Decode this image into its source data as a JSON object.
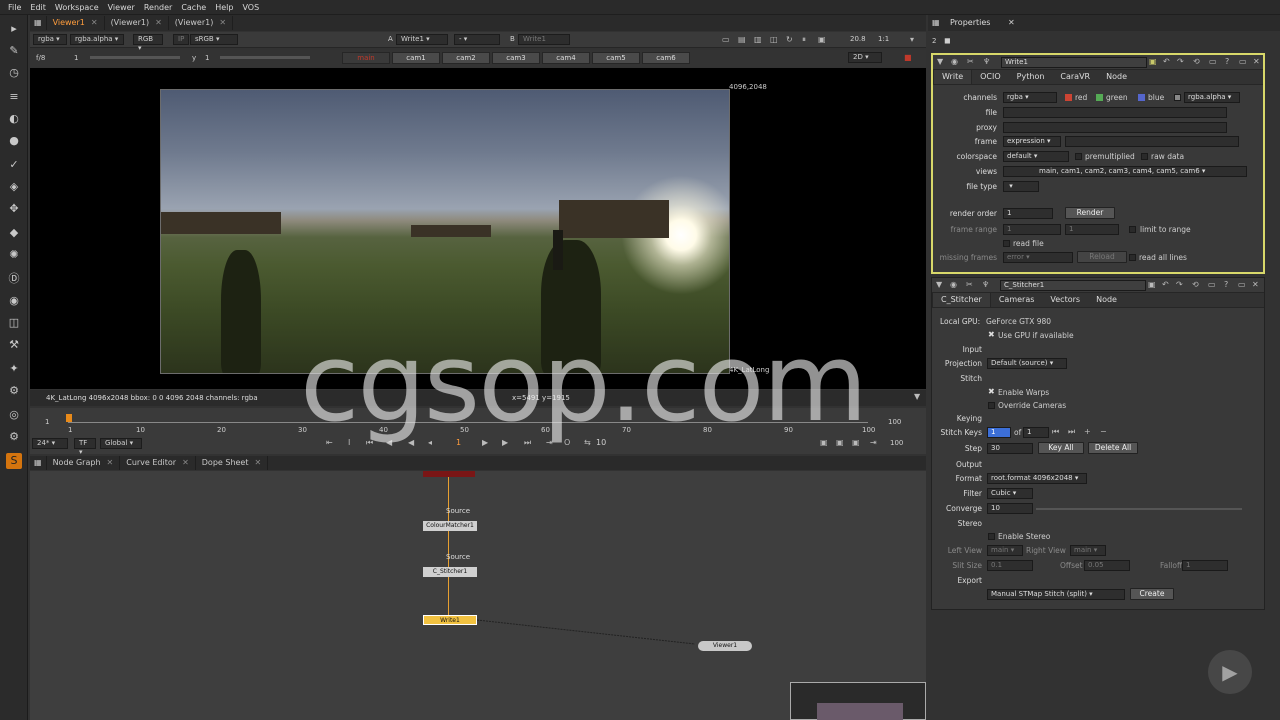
{
  "menu": [
    "File",
    "Edit",
    "Workspace",
    "Viewer",
    "Render",
    "Cache",
    "Help",
    "VOS"
  ],
  "viewer_tabs": [
    "Viewer1",
    "(Viewer1)",
    "(Viewer1)"
  ],
  "viewer_bar": {
    "channel": "rgba",
    "alpha": "rgba.alpha",
    "color": "RGB",
    "ip": "IP",
    "lut": "sRGB",
    "a_label": "A",
    "a_input": "Write1",
    "a_dash": "-",
    "b_label": "B",
    "b_input": "Write1",
    "zoom": "20.8",
    "ratio": "1:1"
  },
  "viewer_bar2": {
    "fstop": "f/8",
    "gain": "1",
    "y_label": "y",
    "y_value": "1",
    "mode": "2D"
  },
  "cams": [
    "main",
    "cam1",
    "cam2",
    "cam3",
    "cam4",
    "cam5",
    "cam6"
  ],
  "viewport": {
    "format_label": "4K_LatLong",
    "corner_label": "4096,2048"
  },
  "info": {
    "left": "4K_LatLong 4096x2048  bbox: 0 0 4096 2048 channels: rgba",
    "coords": "x=5491 y=1915"
  },
  "timeline": {
    "ticks": [
      "1",
      "10",
      "20",
      "30",
      "40",
      "50",
      "60",
      "70",
      "80",
      "90",
      "100"
    ],
    "start": "1",
    "end": "100",
    "fps": "24*",
    "tf": "TF",
    "global": "Global",
    "frame": "1",
    "step": "10",
    "out": "100"
  },
  "ng_tabs": [
    "Node Graph",
    "Curve Editor",
    "Dope Sheet"
  ],
  "nodes": {
    "source1": "Source",
    "colour": "ColourMatcher1",
    "source2": "Source",
    "stitcher": "C_Stitcher1",
    "write": "Write1",
    "viewer": "Viewer1"
  },
  "props": {
    "title": "Properties",
    "count": "2"
  },
  "write": {
    "name": "Write1",
    "tabs": [
      "Write",
      "OCIO",
      "Python",
      "CaraVR",
      "Node"
    ],
    "channels_label": "channels",
    "channels": "rgba",
    "red": "red",
    "green": "green",
    "blue": "blue",
    "alpha": "rgba.alpha",
    "file_label": "file",
    "proxy_label": "proxy",
    "frame_label": "frame",
    "frame": "expression",
    "colorspace_label": "colorspace",
    "colorspace": "default",
    "premult": "premultiplied",
    "rawdata": "raw data",
    "views_label": "views",
    "views": "main, cam1, cam2, cam3, cam4, cam5, cam6",
    "filetype_label": "file type",
    "render_order_label": "render order",
    "render_order": "1",
    "render": "Render",
    "frame_range_label": "frame range",
    "fr1": "1",
    "fr2": "1",
    "limit": "limit to range",
    "read_file": "read file",
    "missing_label": "missing frames",
    "missing": "error",
    "reload": "Reload",
    "read_all": "read all lines"
  },
  "stitcher": {
    "name": "C_Stitcher1",
    "tabs": [
      "C_Stitcher",
      "Cameras",
      "Vectors",
      "Node"
    ],
    "gpu_label": "Local GPU:",
    "gpu": "GeForce GTX 980",
    "use_gpu": "Use GPU if available",
    "input": "Input",
    "projection_label": "Projection",
    "projection": "Default (source)",
    "stitch": "Stitch",
    "enable_warps": "Enable Warps",
    "override": "Override Cameras",
    "keying": "Keying",
    "stitch_keys_label": "Stitch Keys",
    "stitch_key": "1",
    "of": "of",
    "of_val": "1",
    "step_label": "Step",
    "step": "30",
    "keyall": "Key All",
    "deleteall": "Delete All",
    "output": "Output",
    "format_label": "Format",
    "format": "root.format 4096x2048",
    "filter_label": "Filter",
    "filter": "Cubic",
    "converge_label": "Converge",
    "converge": "10",
    "stereo": "Stereo",
    "enable_stereo": "Enable Stereo",
    "left_view_label": "Left View",
    "left_view": "main",
    "right_view_label": "Right View",
    "right_view": "main",
    "slit_label": "Slit Size",
    "slit": "0.1",
    "offset_label": "Offset",
    "offset": "0.05",
    "falloff_label": "Falloff",
    "falloff": "1",
    "export": "Export",
    "export_mode": "Manual STMap Stitch (split)",
    "create": "Create"
  },
  "watermark": "cgsop.com"
}
